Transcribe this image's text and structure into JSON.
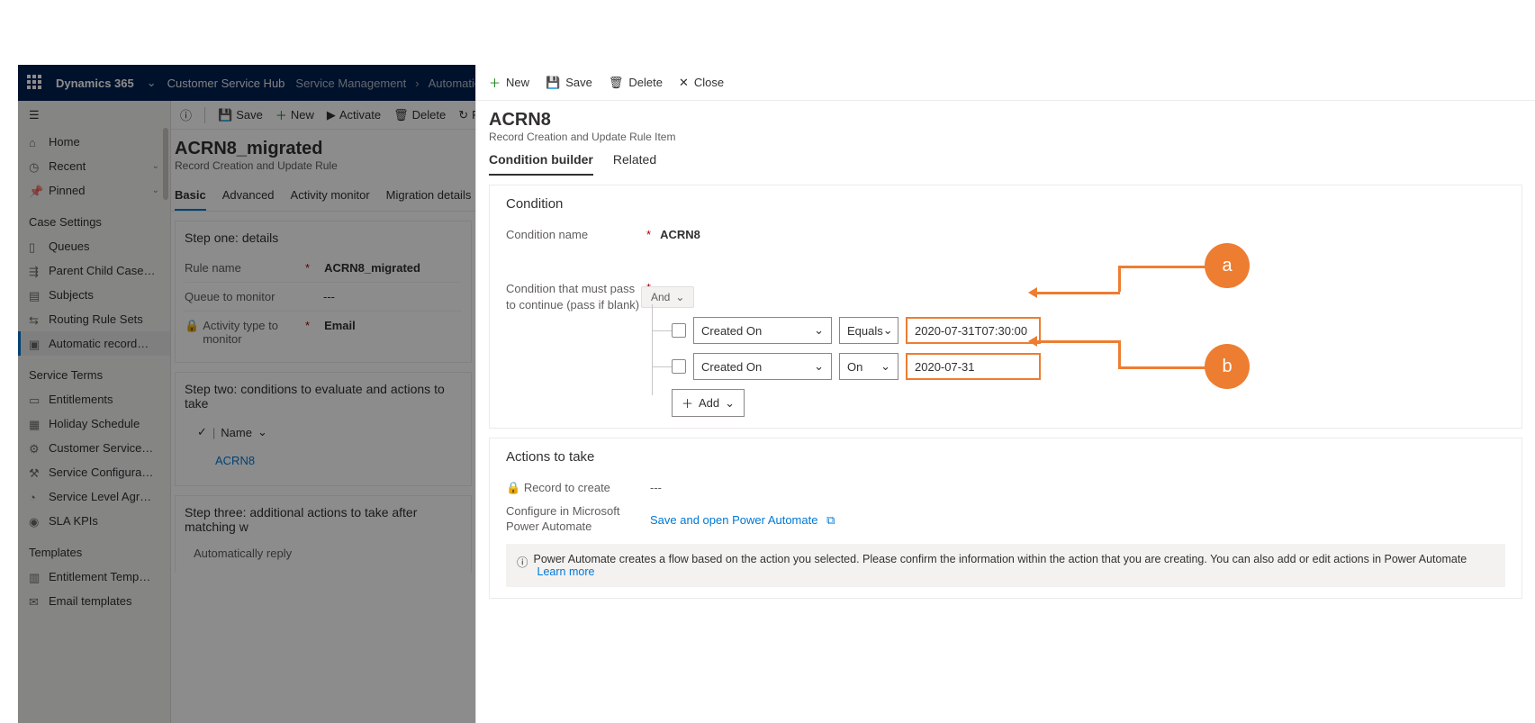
{
  "topbar": {
    "brand": "Dynamics 365",
    "app": "Customer Service Hub",
    "crumb1": "Service Management",
    "crumb2": "Automatic record creation"
  },
  "leftnav": {
    "home": "Home",
    "recent": "Recent",
    "pinned": "Pinned",
    "section_case": "Case Settings",
    "queues": "Queues",
    "parentchild": "Parent Child Case…",
    "subjects": "Subjects",
    "routing": "Routing Rule Sets",
    "auto": "Automatic record…",
    "section_terms": "Service Terms",
    "entitlements": "Entitlements",
    "holiday": "Holiday Schedule",
    "custsvc": "Customer Service…",
    "svcconfig": "Service Configura…",
    "sla": "Service Level Agr…",
    "slakpi": "SLA KPIs",
    "section_templates": "Templates",
    "enttemp": "Entitlement Temp…",
    "emailtemp": "Email templates"
  },
  "under_cmd": {
    "save": "Save",
    "new": "New",
    "activate": "Activate",
    "delete": "Delete",
    "refresh": "Refr"
  },
  "under_head": {
    "title": "ACRN8_migrated",
    "sub": "Record Creation and Update Rule"
  },
  "under_tabs": {
    "basic": "Basic",
    "advanced": "Advanced",
    "activity": "Activity monitor",
    "migration": "Migration details"
  },
  "step1": {
    "title": "Step one: details",
    "rulename_lbl": "Rule name",
    "rulename_val": "ACRN8_migrated",
    "queue_lbl": "Queue to monitor",
    "queue_val": "---",
    "activity_lbl": "Activity type to monitor",
    "activity_val": "Email"
  },
  "step2": {
    "title": "Step two: conditions to evaluate and actions to take",
    "namecol": "Name",
    "row": "ACRN8"
  },
  "step3": {
    "title": "Step three: additional actions to take after matching w",
    "autoreply": "Automatically reply"
  },
  "panel_cmd": {
    "new": "New",
    "save": "Save",
    "delete": "Delete",
    "close": "Close"
  },
  "panel_head": {
    "title": "ACRN8",
    "sub": "Record Creation and Update Rule Item"
  },
  "panel_tabs": {
    "cb": "Condition builder",
    "related": "Related"
  },
  "cond": {
    "section": "Condition",
    "name_lbl": "Condition name",
    "name_val": "ACRN8",
    "pass_lbl": "Condition that must pass to continue (pass if blank)",
    "and": "And",
    "row1_field": "Created On",
    "row1_op": "Equals",
    "row1_val": "2020-07-31T07:30:00",
    "row2_field": "Created On",
    "row2_op": "On",
    "row2_val": "2020-07-31",
    "add": "Add"
  },
  "actions": {
    "section": "Actions to take",
    "record_lbl": "Record to create",
    "record_val": "---",
    "config_lbl": "Configure in Microsoft Power Automate",
    "link": "Save and open Power Automate",
    "banner": "Power Automate creates a flow based on the action you selected. Please confirm the information within the action that you are creating. You can also add or edit actions in Power Automate",
    "learn": "Learn more"
  },
  "annot": {
    "a": "a",
    "b": "b"
  }
}
